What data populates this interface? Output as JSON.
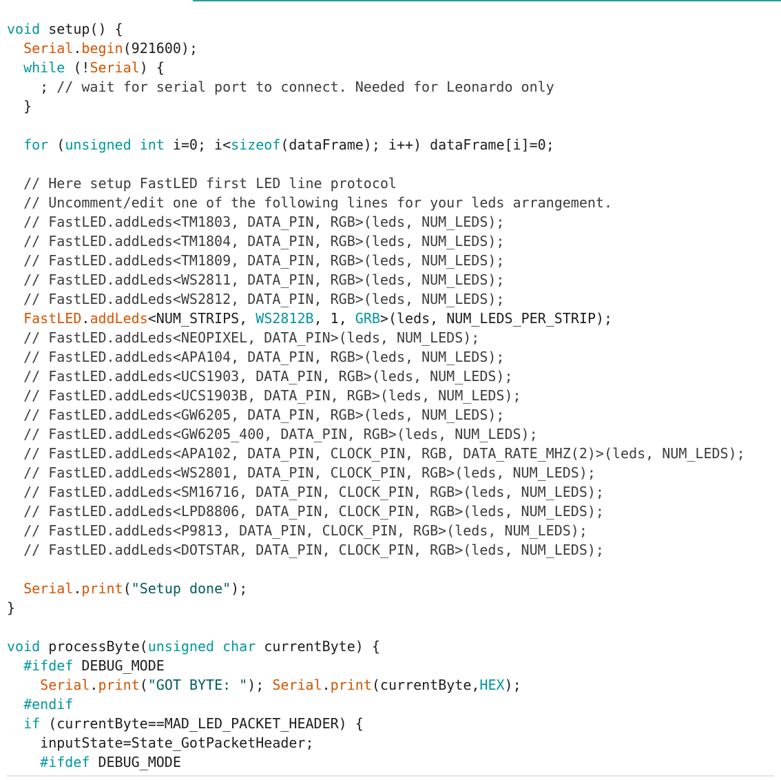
{
  "editor": {
    "language": "cpp",
    "lines": [
      [
        [
          "kw",
          "void"
        ],
        [
          "plain",
          " setup() {"
        ]
      ],
      [
        [
          "plain",
          "  "
        ],
        [
          "obj",
          "Serial"
        ],
        [
          "plain",
          "."
        ],
        [
          "fn",
          "begin"
        ],
        [
          "plain",
          "(921600);"
        ]
      ],
      [
        [
          "plain",
          "  "
        ],
        [
          "kw",
          "while"
        ],
        [
          "plain",
          " (!"
        ],
        [
          "obj",
          "Serial"
        ],
        [
          "plain",
          ") {"
        ]
      ],
      [
        [
          "plain",
          "    ; "
        ],
        [
          "cmt",
          "// wait for serial port to connect. Needed for Leonardo only"
        ]
      ],
      [
        [
          "plain",
          "  }"
        ]
      ],
      [
        [
          "plain",
          ""
        ]
      ],
      [
        [
          "plain",
          "  "
        ],
        [
          "kw",
          "for"
        ],
        [
          "plain",
          " ("
        ],
        [
          "type",
          "unsigned"
        ],
        [
          "plain",
          " "
        ],
        [
          "type",
          "int"
        ],
        [
          "plain",
          " i=0; i<"
        ],
        [
          "kw",
          "sizeof"
        ],
        [
          "plain",
          "(dataFrame); i++) dataFrame[i]=0;"
        ]
      ],
      [
        [
          "plain",
          ""
        ]
      ],
      [
        [
          "plain",
          "  "
        ],
        [
          "cmt",
          "// Here setup FastLED first LED line protocol"
        ]
      ],
      [
        [
          "plain",
          "  "
        ],
        [
          "cmt",
          "// Uncomment/edit one of the following lines for your leds arrangement."
        ]
      ],
      [
        [
          "plain",
          "  "
        ],
        [
          "cmt",
          "// FastLED.addLeds<TM1803, DATA_PIN, RGB>(leds, NUM_LEDS);"
        ]
      ],
      [
        [
          "plain",
          "  "
        ],
        [
          "cmt",
          "// FastLED.addLeds<TM1804, DATA_PIN, RGB>(leds, NUM_LEDS);"
        ]
      ],
      [
        [
          "plain",
          "  "
        ],
        [
          "cmt",
          "// FastLED.addLeds<TM1809, DATA_PIN, RGB>(leds, NUM_LEDS);"
        ]
      ],
      [
        [
          "plain",
          "  "
        ],
        [
          "cmt",
          "// FastLED.addLeds<WS2811, DATA_PIN, RGB>(leds, NUM_LEDS);"
        ]
      ],
      [
        [
          "plain",
          "  "
        ],
        [
          "cmt",
          "// FastLED.addLeds<WS2812, DATA_PIN, RGB>(leds, NUM_LEDS);"
        ]
      ],
      [
        [
          "plain",
          "  "
        ],
        [
          "obj",
          "FastLED"
        ],
        [
          "plain",
          "."
        ],
        [
          "fn",
          "addLeds"
        ],
        [
          "plain",
          "<NUM_STRIPS, "
        ],
        [
          "const",
          "WS2812B"
        ],
        [
          "plain",
          ", 1, "
        ],
        [
          "const",
          "GRB"
        ],
        [
          "plain",
          ">(leds, NUM_LEDS_PER_STRIP);"
        ]
      ],
      [
        [
          "plain",
          "  "
        ],
        [
          "cmt",
          "// FastLED.addLeds<NEOPIXEL, DATA_PIN>(leds, NUM_LEDS);"
        ]
      ],
      [
        [
          "plain",
          "  "
        ],
        [
          "cmt",
          "// FastLED.addLeds<APA104, DATA_PIN, RGB>(leds, NUM_LEDS);"
        ]
      ],
      [
        [
          "plain",
          "  "
        ],
        [
          "cmt",
          "// FastLED.addLeds<UCS1903, DATA_PIN, RGB>(leds, NUM_LEDS);"
        ]
      ],
      [
        [
          "plain",
          "  "
        ],
        [
          "cmt",
          "// FastLED.addLeds<UCS1903B, DATA_PIN, RGB>(leds, NUM_LEDS);"
        ]
      ],
      [
        [
          "plain",
          "  "
        ],
        [
          "cmt",
          "// FastLED.addLeds<GW6205, DATA_PIN, RGB>(leds, NUM_LEDS);"
        ]
      ],
      [
        [
          "plain",
          "  "
        ],
        [
          "cmt",
          "// FastLED.addLeds<GW6205_400, DATA_PIN, RGB>(leds, NUM_LEDS);"
        ]
      ],
      [
        [
          "plain",
          "  "
        ],
        [
          "cmt",
          "// FastLED.addLeds<APA102, DATA_PIN, CLOCK_PIN, RGB, DATA_RATE_MHZ(2)>(leds, NUM_LEDS);"
        ]
      ],
      [
        [
          "plain",
          "  "
        ],
        [
          "cmt",
          "// FastLED.addLeds<WS2801, DATA_PIN, CLOCK_PIN, RGB>(leds, NUM_LEDS);"
        ]
      ],
      [
        [
          "plain",
          "  "
        ],
        [
          "cmt",
          "// FastLED.addLeds<SM16716, DATA_PIN, CLOCK_PIN, RGB>(leds, NUM_LEDS);"
        ]
      ],
      [
        [
          "plain",
          "  "
        ],
        [
          "cmt",
          "// FastLED.addLeds<LPD8806, DATA_PIN, CLOCK_PIN, RGB>(leds, NUM_LEDS);"
        ]
      ],
      [
        [
          "plain",
          "  "
        ],
        [
          "cmt",
          "// FastLED.addLeds<P9813, DATA_PIN, CLOCK_PIN, RGB>(leds, NUM_LEDS);"
        ]
      ],
      [
        [
          "plain",
          "  "
        ],
        [
          "cmt",
          "// FastLED.addLeds<DOTSTAR, DATA_PIN, CLOCK_PIN, RGB>(leds, NUM_LEDS);"
        ]
      ],
      [
        [
          "plain",
          ""
        ]
      ],
      [
        [
          "plain",
          "  "
        ],
        [
          "obj",
          "Serial"
        ],
        [
          "plain",
          "."
        ],
        [
          "fn",
          "print"
        ],
        [
          "plain",
          "("
        ],
        [
          "str",
          "\"Setup done\""
        ],
        [
          "plain",
          ");"
        ]
      ],
      [
        [
          "plain",
          "}"
        ]
      ],
      [
        [
          "plain",
          ""
        ]
      ],
      [
        [
          "kw",
          "void"
        ],
        [
          "plain",
          " processByte("
        ],
        [
          "type",
          "unsigned"
        ],
        [
          "plain",
          " "
        ],
        [
          "type",
          "char"
        ],
        [
          "plain",
          " currentByte) {"
        ]
      ],
      [
        [
          "plain",
          "  "
        ],
        [
          "pre",
          "#ifdef"
        ],
        [
          "plain",
          " DEBUG_MODE"
        ]
      ],
      [
        [
          "plain",
          "    "
        ],
        [
          "obj",
          "Serial"
        ],
        [
          "plain",
          "."
        ],
        [
          "fn",
          "print"
        ],
        [
          "plain",
          "("
        ],
        [
          "str",
          "\"GOT BYTE: \""
        ],
        [
          "plain",
          "); "
        ],
        [
          "obj",
          "Serial"
        ],
        [
          "plain",
          "."
        ],
        [
          "fn",
          "print"
        ],
        [
          "plain",
          "(currentByte,"
        ],
        [
          "const",
          "HEX"
        ],
        [
          "plain",
          ");"
        ]
      ],
      [
        [
          "plain",
          "  "
        ],
        [
          "pre",
          "#endif"
        ]
      ],
      [
        [
          "plain",
          "  "
        ],
        [
          "kw",
          "if"
        ],
        [
          "plain",
          " (currentByte==MAD_LED_PACKET_HEADER) {"
        ]
      ],
      [
        [
          "plain",
          "    inputState=State_GotPacketHeader;"
        ]
      ],
      [
        [
          "plain",
          "    "
        ],
        [
          "pre",
          "#ifdef"
        ],
        [
          "plain",
          " DEBUG_MODE"
        ]
      ]
    ]
  },
  "colors": {
    "keyword": "#00979c",
    "function": "#d35400",
    "string": "#005c5f",
    "comment": "#3c3c3c",
    "text": "#1d1d1d",
    "tab_accent": "#1f9d9d"
  }
}
